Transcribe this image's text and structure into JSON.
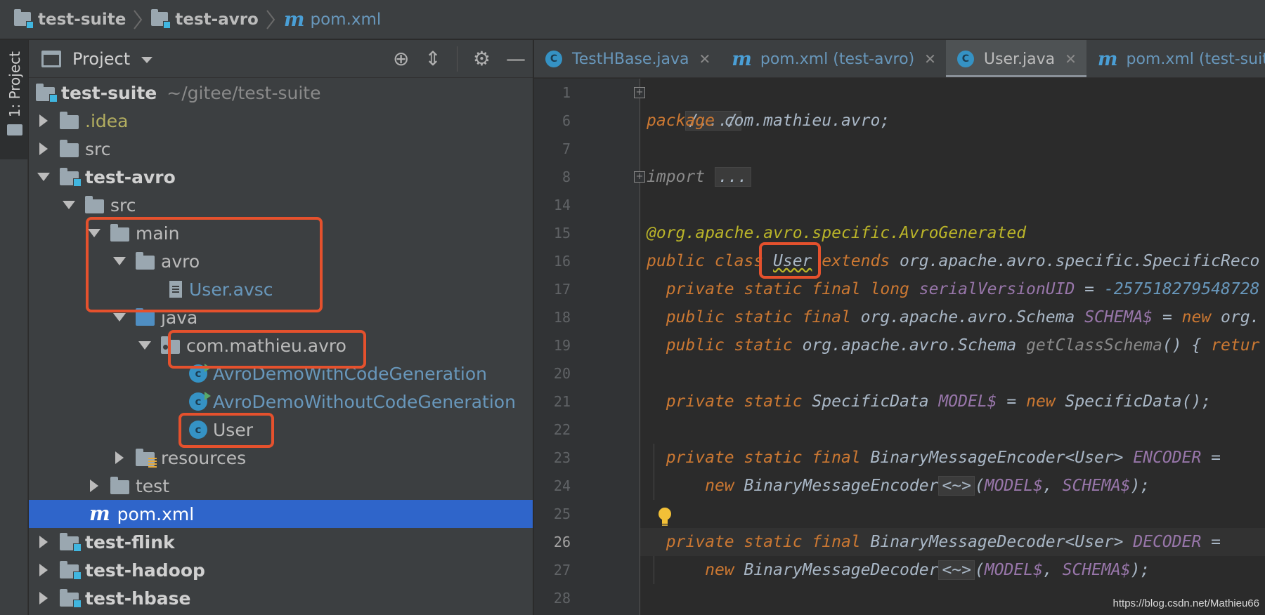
{
  "breadcrumb": [
    {
      "label": "test-suite",
      "icon": "module-folder-icon"
    },
    {
      "label": "test-avro",
      "icon": "module-folder-icon"
    },
    {
      "label": "pom.xml",
      "icon": "maven-m-icon"
    }
  ],
  "stripe": {
    "label": "1: Project"
  },
  "project": {
    "title": "Project",
    "tree": [
      {
        "label": "test-suite",
        "path": "~/gitee/test-suite"
      },
      {
        "label": ".idea"
      },
      {
        "label": "src"
      },
      {
        "label": "test-avro"
      },
      {
        "label": "src"
      },
      {
        "label": "main"
      },
      {
        "label": "avro"
      },
      {
        "label": "User.avsc"
      },
      {
        "label": "java"
      },
      {
        "label": "com.mathieu.avro"
      },
      {
        "label": "AvroDemoWithCodeGeneration"
      },
      {
        "label": "AvroDemoWithoutCodeGeneration"
      },
      {
        "label": "User"
      },
      {
        "label": "resources"
      },
      {
        "label": "test"
      },
      {
        "label": "pom.xml"
      },
      {
        "label": "test-flink"
      },
      {
        "label": "test-hadoop"
      },
      {
        "label": "test-hbase"
      }
    ]
  },
  "tabs": [
    {
      "label": "TestHBase.java",
      "icon": "C",
      "close": "✕"
    },
    {
      "label": "pom.xml (test-avro)",
      "icon": "m",
      "close": "✕"
    },
    {
      "label": "User.java",
      "icon": "C",
      "close": "✕"
    },
    {
      "label": "pom.xml (test-suite)",
      "icon": "m"
    }
  ],
  "editor": {
    "line_numbers": [
      "1",
      "6",
      "7",
      "8",
      "14",
      "15",
      "16",
      "17",
      "18",
      "19",
      "20",
      "21",
      "22",
      "23",
      "24",
      "25",
      "26",
      "27",
      "28"
    ],
    "current_line": "26",
    "code": {
      "l1": "/.../",
      "l6_kw": "package",
      "l6_rest": " com.mathieu.avro;",
      "l8_kw": "import",
      "l8_fold": "...",
      "l15": "@org.apache.avro.specific.",
      "l15_ann": "AvroGenerated",
      "l16_kw": "public class ",
      "l16_cls": "User",
      "l16_ext": " extends",
      "l16_rest": " org.apache.avro.specific.SpecificReco",
      "l17_kw": "private static final long ",
      "l17_fld": "serialVersionUID",
      "l17_eq": " = ",
      "l17_num": "-257518279548728",
      "l18_kw": "public static final",
      "l18_type": " org.apache.avro.Schema ",
      "l18_fld": "SCHEMA$",
      "l18_eq": " = ",
      "l18_new": "new",
      "l18_rest": " org.",
      "l19_kw": "public static",
      "l19_type": " org.apache.avro.Schema ",
      "l19_m": "getClassSchema",
      "l19_paren": "() { ",
      "l19_ret": "retur",
      "l21_kw": "private static",
      "l21_type": " SpecificData ",
      "l21_fld": "MODEL$",
      "l21_eq": " = ",
      "l21_new": "new",
      "l21_rest": " SpecificData();",
      "l23_kw": "private static final",
      "l23_type": " BinaryMessageEncoder<User> ",
      "l23_fld": "ENCODER",
      "l23_eq": " =",
      "l24_new": "new",
      "l24_type": " BinaryMessageEncoder",
      "l24_fold": "<~>",
      "l24_open": "(",
      "l24_f1": "MODEL$",
      "l24_comma": ", ",
      "l24_f2": "SCHEMA$",
      "l24_close": ");",
      "l26_kw": "private static final",
      "l26_type": " BinaryMessageDecoder<User> ",
      "l26_fld": "DECODER",
      "l26_eq": " =",
      "l27_new": "new",
      "l27_type": " BinaryMessageDecoder",
      "l27_fold": "<~>",
      "l27_open": "(",
      "l27_f1": "MODEL$",
      "l27_comma": ", ",
      "l27_f2": "SCHEMA$",
      "l27_close": ");"
    }
  },
  "watermark": "https://blog.csdn.net/Mathieu66",
  "colors": {
    "accent_highlight": "#e5512d",
    "selection": "#2f65ca",
    "keyword": "#cc7832",
    "field": "#9876aa",
    "annotation": "#bbb529"
  }
}
